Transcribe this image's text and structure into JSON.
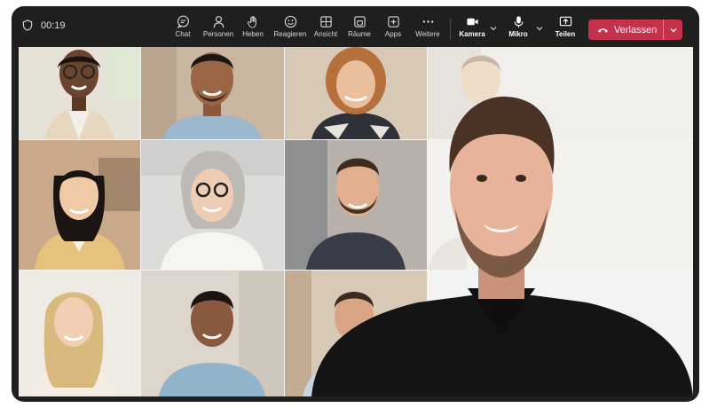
{
  "call": {
    "timer": "00:19"
  },
  "toolbar": {
    "items": [
      {
        "id": "chat",
        "label": "Chat"
      },
      {
        "id": "people",
        "label": "Personen"
      },
      {
        "id": "raise",
        "label": "Heben"
      },
      {
        "id": "react",
        "label": "Reagieren"
      },
      {
        "id": "view",
        "label": "Ansicht"
      },
      {
        "id": "rooms",
        "label": "Räume"
      },
      {
        "id": "apps",
        "label": "Apps"
      },
      {
        "id": "more",
        "label": "Weitere"
      }
    ],
    "camera_label": "Kamera",
    "mic_label": "Mikro",
    "share_label": "Teilen",
    "leave_label": "Verlassen"
  },
  "colors": {
    "window": "#1f1f1f",
    "leave_button": "#c4314b",
    "stage": "#f3f3f3"
  }
}
